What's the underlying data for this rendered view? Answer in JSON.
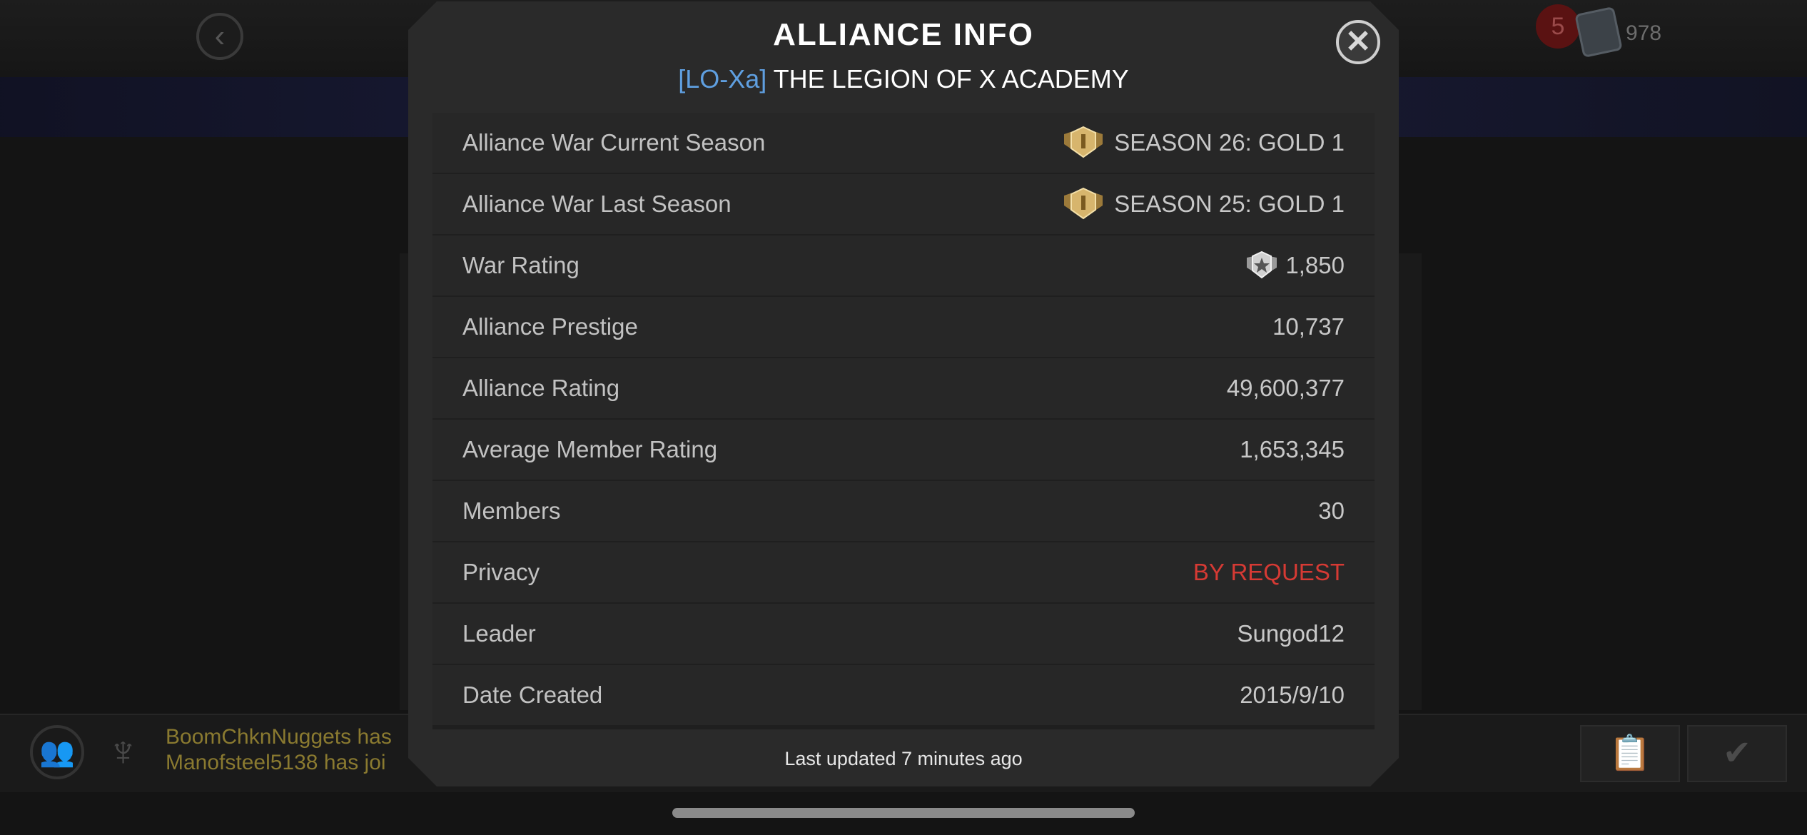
{
  "background": {
    "notification_count": "5",
    "card_count": "978",
    "feed": [
      "BoomChknNuggets has",
      "Manofsteel5138 has joi"
    ]
  },
  "modal": {
    "title": "ALLIANCE INFO",
    "tag": "[LO-Xa]",
    "name": "THE LEGION OF X ACADEMY",
    "rows": [
      {
        "label": "Alliance War Current Season",
        "value": "SEASON 26: GOLD 1"
      },
      {
        "label": "Alliance War Last Season",
        "value": "SEASON 25: GOLD 1"
      },
      {
        "label": "War Rating",
        "value": "1,850"
      },
      {
        "label": "Alliance Prestige",
        "value": "10,737"
      },
      {
        "label": "Alliance Rating",
        "value": "49,600,377"
      },
      {
        "label": "Average Member Rating",
        "value": "1,653,345"
      },
      {
        "label": "Members",
        "value": "30"
      },
      {
        "label": "Privacy",
        "value": "BY REQUEST"
      },
      {
        "label": "Leader",
        "value": "Sungod12"
      },
      {
        "label": "Date Created",
        "value": "2015/9/10"
      }
    ],
    "footer": "Last updated 7 minutes ago"
  },
  "icons": {
    "close": "close-icon",
    "rank": "gold-rank-badge-icon",
    "war_rating": "war-rating-emblem-icon",
    "back": "back-arrow-icon"
  },
  "colors": {
    "tag": "#5f9fe0",
    "privacy": "#d63a34",
    "modal_bg": "#2a2a2a",
    "row_bg": "#272727"
  }
}
